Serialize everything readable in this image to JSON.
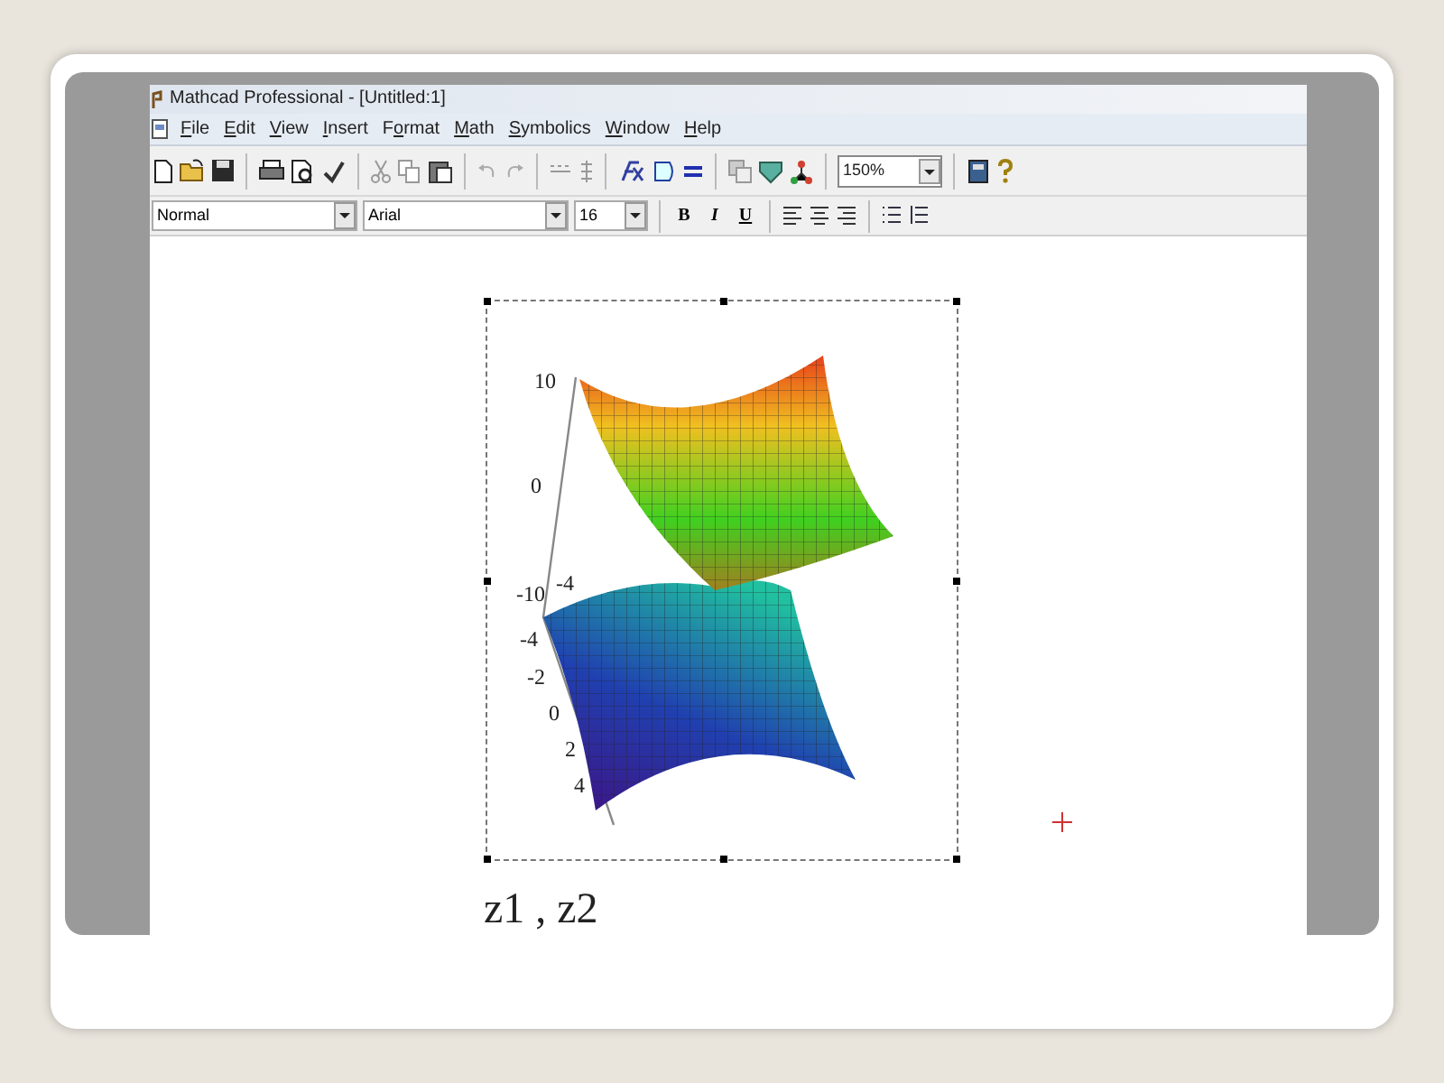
{
  "window": {
    "title": "Mathcad Professional - [Untitled:1]"
  },
  "menu": [
    {
      "mnemonic": "F",
      "rest": "ile"
    },
    {
      "mnemonic": "E",
      "rest": "dit"
    },
    {
      "mnemonic": "V",
      "rest": "iew"
    },
    {
      "mnemonic": "I",
      "rest": "nsert"
    },
    {
      "before": "F",
      "mnemonic": "o",
      "rest": "rmat"
    },
    {
      "mnemonic": "M",
      "rest": "ath"
    },
    {
      "mnemonic": "S",
      "rest": "ymbolics"
    },
    {
      "mnemonic": "W",
      "rest": "indow"
    },
    {
      "mnemonic": "H",
      "rest": "elp"
    }
  ],
  "toolbar": {
    "zoom": "150%"
  },
  "format_bar": {
    "style": "Normal",
    "font": "Arial",
    "size": "16",
    "bold": "B",
    "italic": "I",
    "underline": "U"
  },
  "plot": {
    "z_ticks": [
      "10",
      "0",
      "-10"
    ],
    "x_ticks": [
      "-4"
    ],
    "y_ticks": [
      "-4",
      "-2",
      "0",
      "2",
      "4"
    ],
    "label": "z1 , z2"
  }
}
